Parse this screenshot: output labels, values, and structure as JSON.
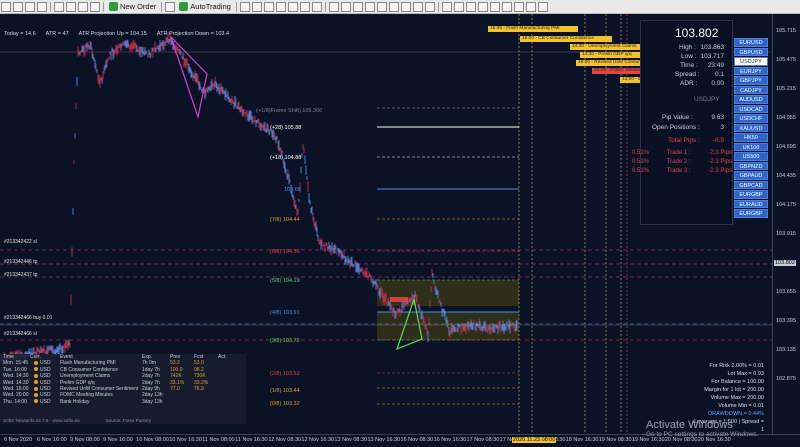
{
  "toolbar": {
    "new_order": "New Order",
    "auto_trading": "AutoTrading"
  },
  "indicator_line": {
    "today": "Today = 14.6",
    "atr": "ATR = 47",
    "atr_up": "ATR Projection Up = 104.15",
    "atr_down": "ATR Projection Down = 103.4"
  },
  "panel": {
    "price": "103.802",
    "high_label": "High :",
    "high_value": "103.863",
    "low_label": "Low :",
    "low_value": "103.717",
    "time_label": "Time :",
    "time_value": "23:49",
    "spread_label": "Spread :",
    "spread_value": "0.1",
    "adr_label": "ADR :",
    "adr_value": "0.00",
    "pair_label": "USDJPY",
    "pip_label": "Pip Value :",
    "pip_value": "9.63",
    "open_label": "Open Positions :",
    "open_value": "3",
    "total_label": "Total Pips :",
    "total_value": "-6.9"
  },
  "symbols": [
    "EURUSD",
    "GBPUSD",
    "USDJPY",
    "EURJPY",
    "GBPJPY",
    "CADJPY",
    "AUDUSD",
    "USDCAD",
    "USDCHF",
    "XAUUSD",
    "HK50",
    "UK100",
    "US500",
    "GBPNZD",
    "GBPAUD",
    "GBPCAD",
    "EURGBP",
    "EURAUD",
    "EURGBP"
  ],
  "active_symbol_index": 2,
  "news": [
    {
      "text": "15:45 - Flash Manufacturing PMI",
      "color": "#f2c230"
    },
    {
      "text": "16:00 - CB Consumer Confidence",
      "color": "#f2c230"
    },
    {
      "text": "14:30 - Unemployment Claims",
      "color": "#f2c230"
    },
    {
      "text": "14:30 - Prelim GDP q/q",
      "color": "#f2c230"
    },
    {
      "text": "16:00 - Revised UoM Consumer S...",
      "color": "#f2c230"
    },
    {
      "text": "20:00 - FOMC Meeting Minutes",
      "color": "#e04444"
    },
    {
      "text": "14:00 - Bank Holiday",
      "color": "#f2c230"
    }
  ],
  "trades": [
    {
      "pct": "0.51%",
      "name": "Trade 1 :",
      "pips": "-2.3 Pips"
    },
    {
      "pct": "0.51%",
      "name": "Trade 2 :",
      "pips": "-2.3 Pips"
    },
    {
      "pct": "0.51%",
      "name": "Trade 3 :",
      "pips": "-2.3 Pips"
    }
  ],
  "fib_levels": [
    {
      "label": "(+28)  105.88",
      "color": "#ffffff"
    },
    {
      "label": "(+18)  104.88",
      "color": "#ffffff"
    },
    {
      "label": "104.68",
      "color": "#4d8fe8"
    },
    {
      "label": "(7/8)  104.44",
      "color": "#e0a030"
    },
    {
      "label": "(6/8)  104.36",
      "color": "#e04444"
    },
    {
      "label": "(5/8)  104.19",
      "color": "#5fd35f"
    },
    {
      "label": "(4/8)  103.91",
      "color": "#4d8fe8"
    },
    {
      "label": "(3/8)  103.72",
      "color": "#5fd35f"
    },
    {
      "label": "(2/8)  103.52",
      "color": "#e04444"
    },
    {
      "label": "(1/8)  103.44",
      "color": "#e0a030"
    },
    {
      "label": "(0/8)  103.32",
      "color": "#e0a030"
    }
  ],
  "frame_label": "(+1/8)Frame Shift)  105.306",
  "trade_labels": [
    "#213342422 sl",
    "#213342446 tp",
    "#213342437 tp",
    "#213342466 buy 0.01",
    "#213342466 sl"
  ],
  "risk": {
    "risk": "For Risk 2.00% = 0.01",
    "lot_max": "Lot Max = 0.93",
    "balance": "For Balance = 100.00",
    "margin": "Margin for 1 lot = 200.00",
    "volume_max": "Volume Max = 200.00",
    "volume_min": "Volume Min = 0.01",
    "drawdown": "DRAWDOWN = 0.44%",
    "leverage": "Leverage = 1:500 | Spread = 1"
  },
  "calendar": {
    "headers": [
      "Time",
      "Curr.",
      "Event",
      "Exp.",
      "Prev",
      "Fcst",
      "Act"
    ],
    "rows": [
      {
        "time": "Mon. 15:45",
        "cur": "USD",
        "event": "Flash Manufacturing PMI",
        "exp": "7h 0m",
        "prev": "53.2",
        "fcst": "53.0",
        "act": ""
      },
      {
        "time": "Tue. 16:00",
        "cur": "USD",
        "event": "CB Consumer Confidence",
        "exp": "1day 7h",
        "prev": "100.9",
        "fcst": "98.2",
        "act": ""
      },
      {
        "time": "Wed. 14:30",
        "cur": "USD",
        "event": "Unemployment Claims",
        "exp": "2day 7h",
        "prev": "742K",
        "fcst": "730K",
        "act": ""
      },
      {
        "time": "Wed. 14:30",
        "cur": "USD",
        "event": "Prelim GDP q/q",
        "exp": "2day 7h",
        "prev": "33.1%",
        "fcst": "33.2%",
        "act": ""
      },
      {
        "time": "Wed. 16:00",
        "cur": "USD",
        "event": "Revised UoM Consumer Sentiment",
        "exp": "2day 9h",
        "prev": "77.0",
        "fcst": "76.9",
        "act": ""
      },
      {
        "time": "Wed. 20:00",
        "cur": "USD",
        "event": "FOMC Meeting Minutes",
        "exp": "2day 13h",
        "prev": "",
        "fcst": "",
        "act": ""
      },
      {
        "time": "Thu. 14:00",
        "cur": "USD",
        "event": "Bank Holiday",
        "exp": "3day 13h",
        "prev": "",
        "fcst": "",
        "act": ""
      }
    ],
    "footer_left": "SoftX NewsInfo v2.7.8 - www.softx.eu",
    "footer_right": "Source: Forex Factory"
  },
  "price_ticks": [
    "105.715",
    "105.475",
    "105.215",
    "104.955",
    "104.695",
    "104.435",
    "104.175",
    "103.915",
    "103.802",
    "103.655",
    "103.395",
    "103.135",
    "102.875"
  ],
  "time_ticks": [
    "6 Nov 2020",
    "6 Nov 16:00",
    "9 Nov 08:00",
    "9 Nov 16:00",
    "10 Nov 08:00",
    "10 Nov 16:30",
    "11 Nov 08:00",
    "11 Nov 16:30",
    "12 Nov 08:30",
    "12 Nov 16:30",
    "13 Nov 08:30",
    "13 Nov 16:30",
    "16 Nov 08:30",
    "16 Nov 16:30",
    "17 Nov 08:30",
    "17 Nov 16:30",
    "18 Nov 08:30",
    "18 Nov 16:30",
    "19 Nov 08:30",
    "19 Nov 16:30",
    "20 Nov 08:30",
    "20 Nov 16:30",
    "2020.11.23 08:00"
  ],
  "watermark": {
    "line1": "Activate Windows",
    "line2": "Go to PC settings to activate Windows."
  },
  "colors": {
    "background": "#0b1226",
    "candle_up": "#4d8fe8",
    "candle_down": "#c0304a",
    "symbol_button": "#2d64c8"
  }
}
